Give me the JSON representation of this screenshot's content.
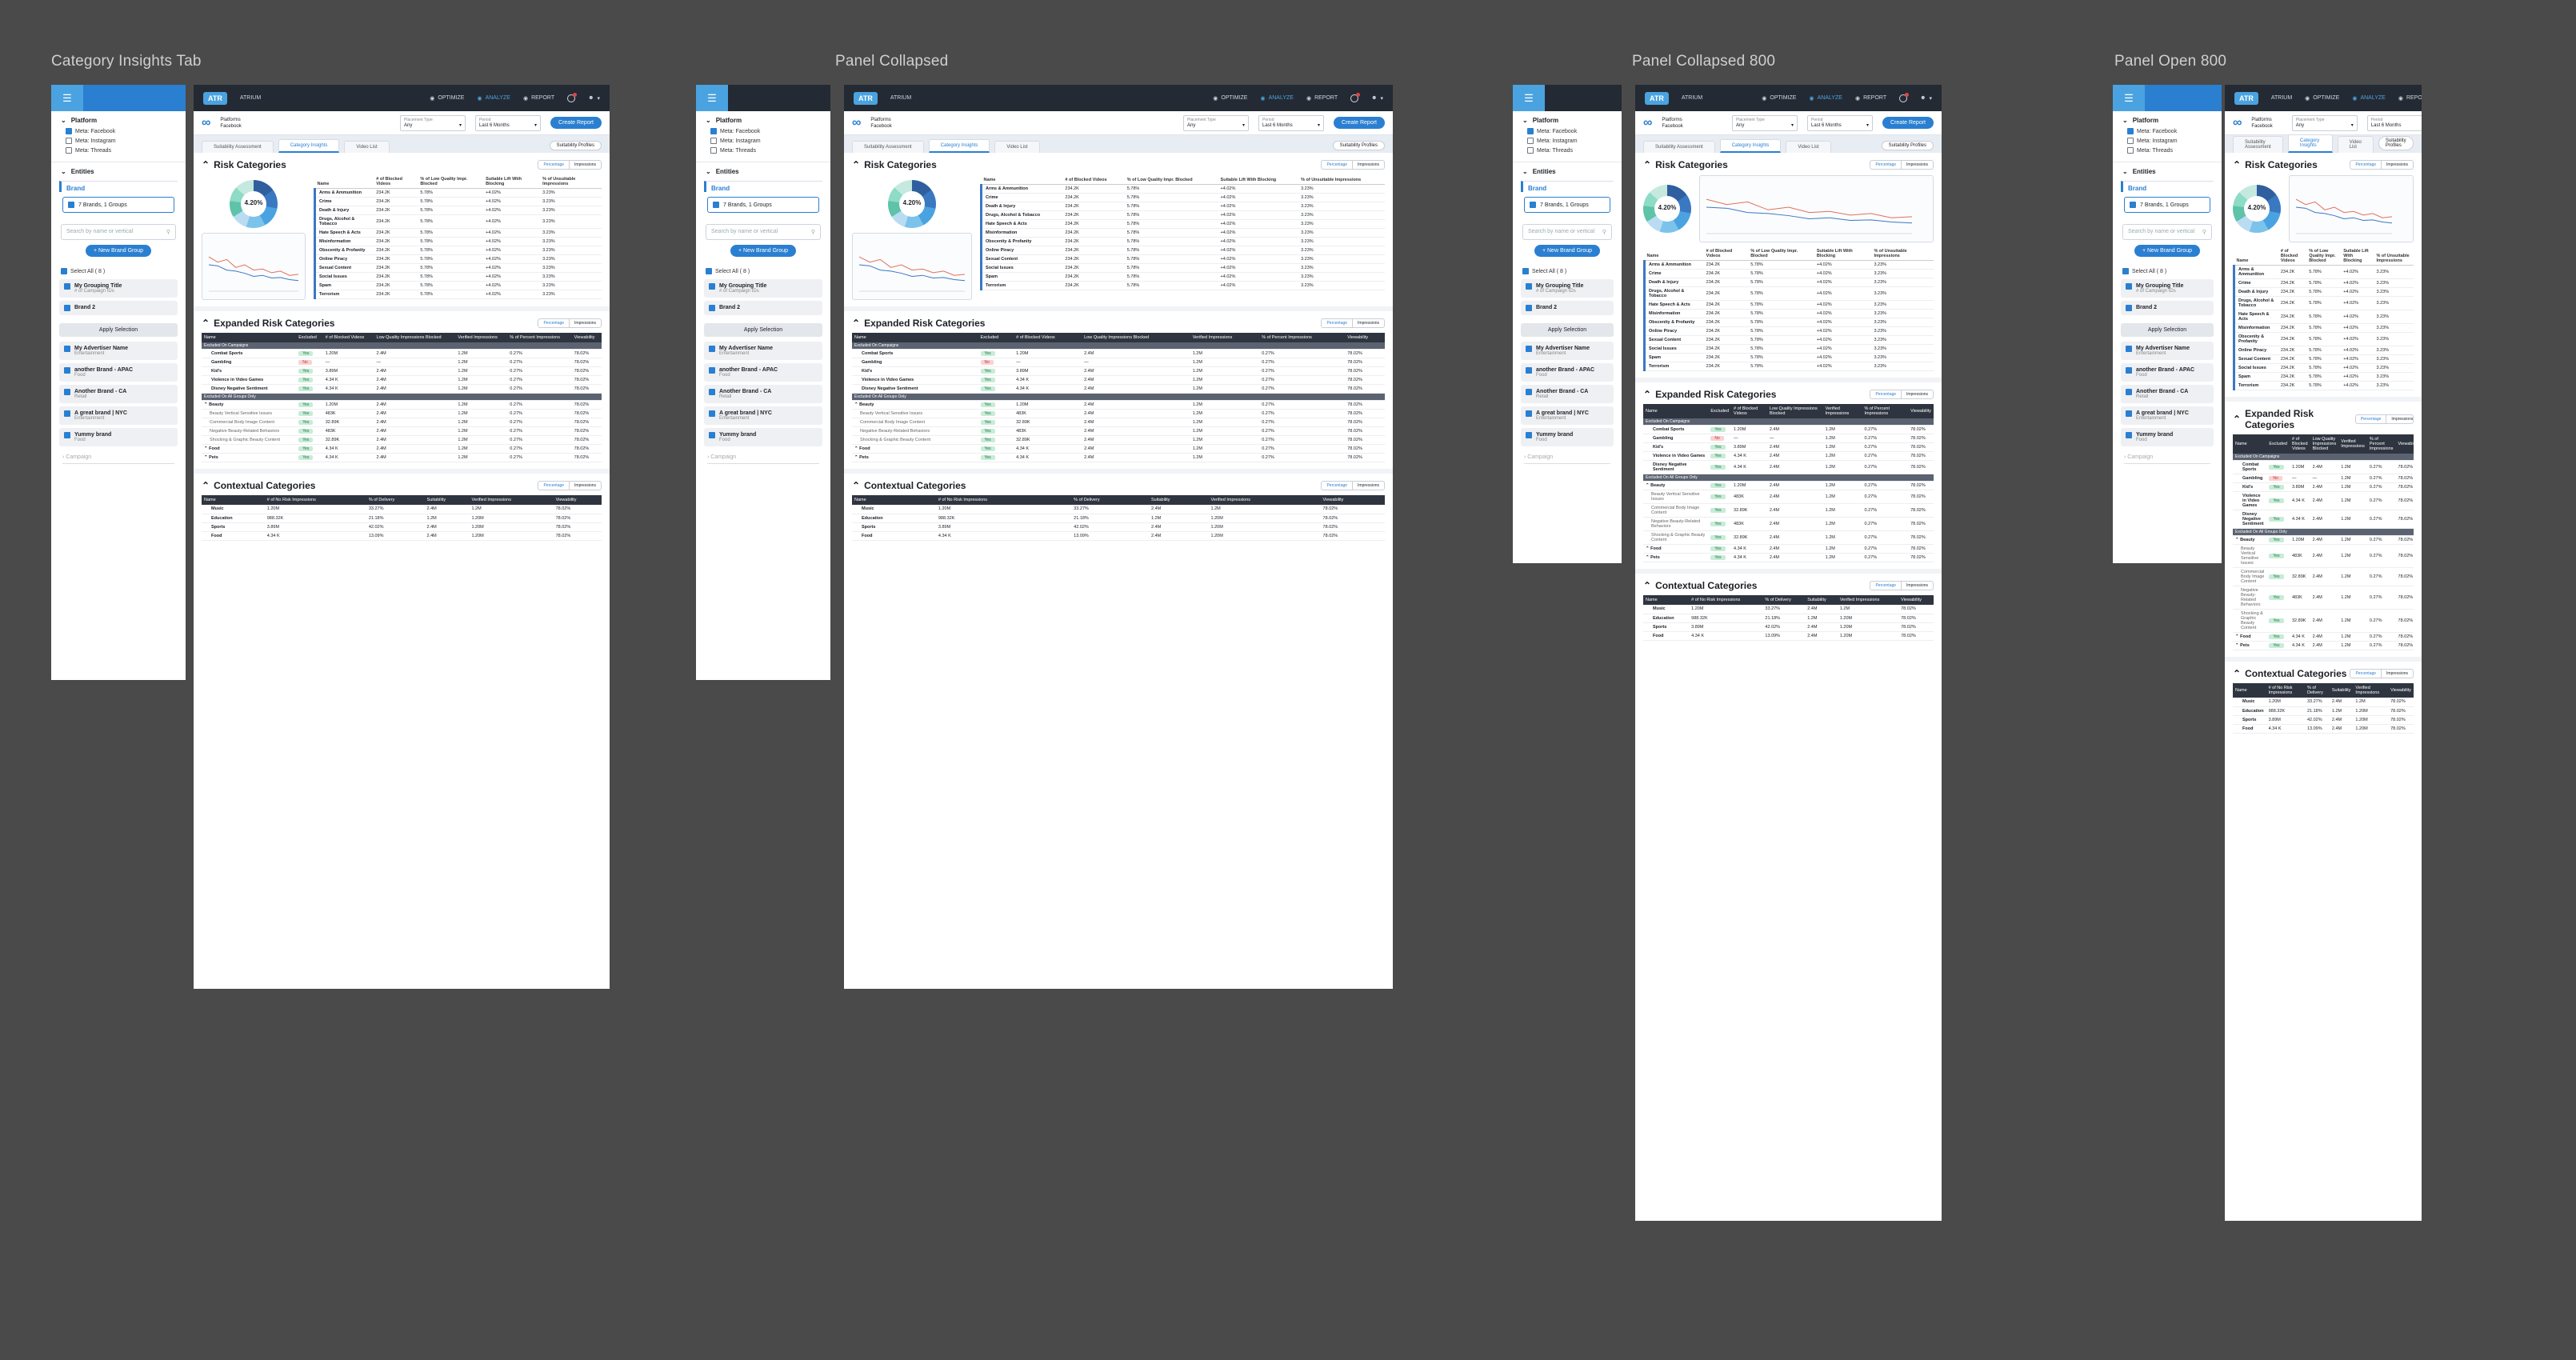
{
  "frames": {
    "f1": "Category Insights Tab",
    "f2": "Panel Collapsed",
    "f3": "Panel Collapsed 800",
    "f4": "Panel Open 800"
  },
  "topnav": {
    "logo": "",
    "brand": "ATRIUM",
    "nav": [
      "OPTIMIZE",
      "ANALYZE",
      "REPORT"
    ]
  },
  "sidebar": {
    "platform": "Platform",
    "platforms": [
      "Meta: Facebook",
      "Meta: Instagram",
      "Meta: Threads"
    ],
    "entities": "Entities",
    "brand": "Brand",
    "selected": "7 Brands, 1 Groups",
    "search_placeholder": "Search by name or vertical",
    "new_group": "+ New Brand Group",
    "select_all": "Select All ( 8 )",
    "items": [
      {
        "name": "My Grouping Title",
        "sub": "# of Campaign IDs"
      },
      {
        "name": "Brand 2",
        "sub": ""
      }
    ],
    "apply": "Apply Selection",
    "advertisers": [
      {
        "name": "My Advertiser Name",
        "sub": "Entertainment"
      },
      {
        "name": "another Brand - APAC",
        "sub": "Food"
      },
      {
        "name": "Another Brand - CA",
        "sub": "Retail"
      },
      {
        "name": "A great brand | NYC",
        "sub": "Entertainment"
      },
      {
        "name": "Yummy brand",
        "sub": "Food"
      }
    ],
    "campaign": "Campaign"
  },
  "filter": {
    "platform_label": "Platforms",
    "platform_value": "Facebook",
    "placement_label": "Placement Type",
    "placement_value": "Any",
    "period_label": "Period",
    "period_value": "Last 6 Months",
    "create": "Create Report"
  },
  "tabs": [
    "Suitability Assessment",
    "Category Insights",
    "Video List"
  ],
  "suitability_profiles": "Suitability Profiles",
  "risk": {
    "title": "Risk Categories",
    "toggle": [
      "Percentage",
      "Impressions"
    ],
    "donut_value": "4.20%",
    "headers": [
      "Name",
      "# of Blocked Videos",
      "% of Low Quality Impr. Blocked",
      "Suitable Lift With Blocking",
      "% of Unsuitable Impressions"
    ],
    "rows": [
      [
        "Arms & Ammunition",
        "234.2K",
        "5.78%",
        "+4.02%",
        "3.23%"
      ],
      [
        "Crime",
        "234.2K",
        "5.78%",
        "+4.02%",
        "3.23%"
      ],
      [
        "Death & Injury",
        "234.2K",
        "5.78%",
        "+4.02%",
        "3.23%"
      ],
      [
        "Drugs, Alcohol & Tobacco",
        "234.2K",
        "5.78%",
        "+4.02%",
        "3.23%"
      ],
      [
        "Hate Speech & Acts",
        "234.2K",
        "5.78%",
        "+4.02%",
        "3.23%"
      ],
      [
        "Misinformation",
        "234.2K",
        "5.78%",
        "+4.02%",
        "3.23%"
      ],
      [
        "Obscenity & Profanity",
        "234.2K",
        "5.78%",
        "+4.02%",
        "3.23%"
      ],
      [
        "Online Piracy",
        "234.2K",
        "5.78%",
        "+4.02%",
        "3.23%"
      ],
      [
        "Sexual Content",
        "234.2K",
        "5.78%",
        "+4.02%",
        "3.23%"
      ],
      [
        "Social Issues",
        "234.2K",
        "5.78%",
        "+4.02%",
        "3.23%"
      ],
      [
        "Spam",
        "234.2K",
        "5.78%",
        "+4.02%",
        "3.23%"
      ],
      [
        "Terrorism",
        "234.2K",
        "5.78%",
        "+4.02%",
        "3.23%"
      ]
    ]
  },
  "expanded": {
    "title": "Expanded Risk Categories",
    "headers": [
      "Name",
      "Excluded",
      "# of Blocked Videos",
      "Low Quality Impressions Blocked",
      "Verified Impressions",
      "% of Percent Impressions",
      "Viewability"
    ],
    "group1": "Excluded On Campaigns",
    "rows1": [
      [
        "Combat Sports",
        "Yes",
        "1.20M",
        "2.4M",
        "1.2M",
        "0.27%",
        "78.02%"
      ],
      [
        "Gambling",
        "No",
        "—",
        "—",
        "1.2M",
        "0.27%",
        "78.02%"
      ],
      [
        "Kid's",
        "Yes",
        "3.89M",
        "2.4M",
        "1.2M",
        "0.27%",
        "78.02%"
      ],
      [
        "Violence in Video Games",
        "Yes",
        "4.34 K",
        "2.4M",
        "1.2M",
        "0.27%",
        "78.02%"
      ],
      [
        "Disney Negative Sentiment",
        "Yes",
        "4.34 K",
        "2.4M",
        "1.2M",
        "0.27%",
        "78.02%"
      ]
    ],
    "group2": "Excluded On All Groups Only",
    "rows2": [
      [
        "Beauty",
        "Yes",
        "1.20M",
        "2.4M",
        "1.2M",
        "0.27%",
        "78.02%"
      ],
      [
        "Beauty Vertical Sensitive Issues",
        "Yes",
        "483K",
        "2.4M",
        "1.2M",
        "0.27%",
        "78.02%"
      ],
      [
        "Commercial Body Image Content",
        "Yes",
        "32.89K",
        "2.4M",
        "1.2M",
        "0.27%",
        "78.02%"
      ],
      [
        "Negative Beauty-Related Behaviors",
        "Yes",
        "483K",
        "2.4M",
        "1.2M",
        "0.27%",
        "78.02%"
      ],
      [
        "Shocking & Graphic Beauty Content",
        "Yes",
        "32.89K",
        "2.4M",
        "1.2M",
        "0.27%",
        "78.02%"
      ],
      [
        "Food",
        "Yes",
        "4.34 K",
        "2.4M",
        "1.2M",
        "0.27%",
        "78.02%"
      ],
      [
        "Pets",
        "Yes",
        "4.34 K",
        "2.4M",
        "1.2M",
        "0.27%",
        "78.02%"
      ]
    ]
  },
  "contextual": {
    "title": "Contextual Categories",
    "headers": [
      "Name",
      "# of No Risk Impressions",
      "% of Delivery",
      "Suitability",
      "Verified Impressions",
      "Viewability"
    ],
    "rows": [
      [
        "Music",
        "1.20M",
        "33.27%",
        "2.4M",
        "1.2M",
        "78.02%"
      ],
      [
        "Education",
        "988.32K",
        "21.18%",
        "1.2M",
        "1.20M",
        "78.02%"
      ],
      [
        "Sports",
        "3.89M",
        "42.02%",
        "2.4M",
        "1.20M",
        "78.02%"
      ],
      [
        "Food",
        "4.34 K",
        "13.09%",
        "2.4M",
        "1.20M",
        "78.02%"
      ]
    ]
  }
}
